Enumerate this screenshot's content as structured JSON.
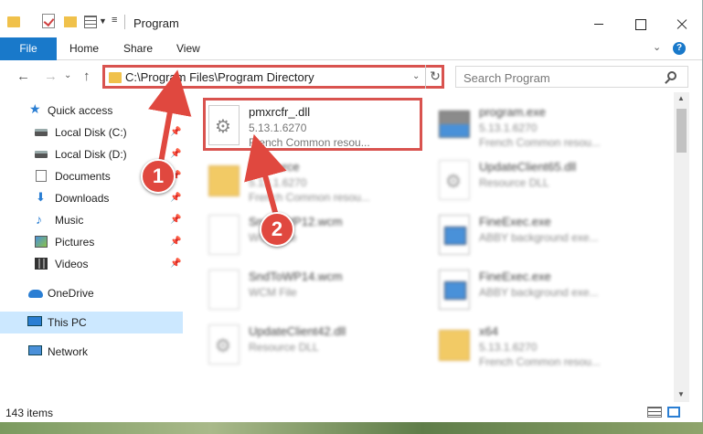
{
  "window": {
    "title": "Program"
  },
  "ribbon": {
    "file": "File",
    "home": "Home",
    "share": "Share",
    "view": "View",
    "help": "?"
  },
  "navbar": {
    "address": "C:\\Program Files\\Program Directory",
    "search_placeholder": "Search Program"
  },
  "sidebar": {
    "items": [
      {
        "label": "Quick access"
      },
      {
        "label": "Local Disk (C:)"
      },
      {
        "label": "Local Disk (D:)"
      },
      {
        "label": "Documents"
      },
      {
        "label": "Downloads"
      },
      {
        "label": "Music"
      },
      {
        "label": "Pictures"
      },
      {
        "label": "Videos"
      },
      {
        "label": "OneDrive"
      },
      {
        "label": "This PC"
      },
      {
        "label": "Network"
      }
    ]
  },
  "files": [
    {
      "name": "pmxrcfr_.dll",
      "line1": "5.13.1.6270",
      "line2": "French Common resou..."
    },
    {
      "name": "program.exe",
      "line1": "5.13.1.6270",
      "line2": "French Common resou..."
    },
    {
      "name": "Resource",
      "line1": "5.13.1.6270",
      "line2": "French Common resou..."
    },
    {
      "name": "UpdateClient65.dll",
      "line1": "Resource DLL",
      "line2": ""
    },
    {
      "name": "SndToWP12.wcm",
      "line1": "WCM File",
      "line2": ""
    },
    {
      "name": "FineExec.exe",
      "line1": "ABBY background exe...",
      "line2": ""
    },
    {
      "name": "SndToWP14.wcm",
      "line1": "WCM File",
      "line2": ""
    },
    {
      "name": "FineExec.exe",
      "line1": "ABBY background exe...",
      "line2": ""
    },
    {
      "name": "UpdateClient42.dll",
      "line1": "Resource DLL",
      "line2": ""
    },
    {
      "name": "x64",
      "line1": "5.13.1.6270",
      "line2": "French Common resou..."
    }
  ],
  "status": {
    "count": "143 items"
  },
  "callouts": {
    "one": "1",
    "two": "2"
  },
  "colors": {
    "accent": "#1979ca",
    "highlight": "#d9534f",
    "selected": "#cce8ff"
  }
}
